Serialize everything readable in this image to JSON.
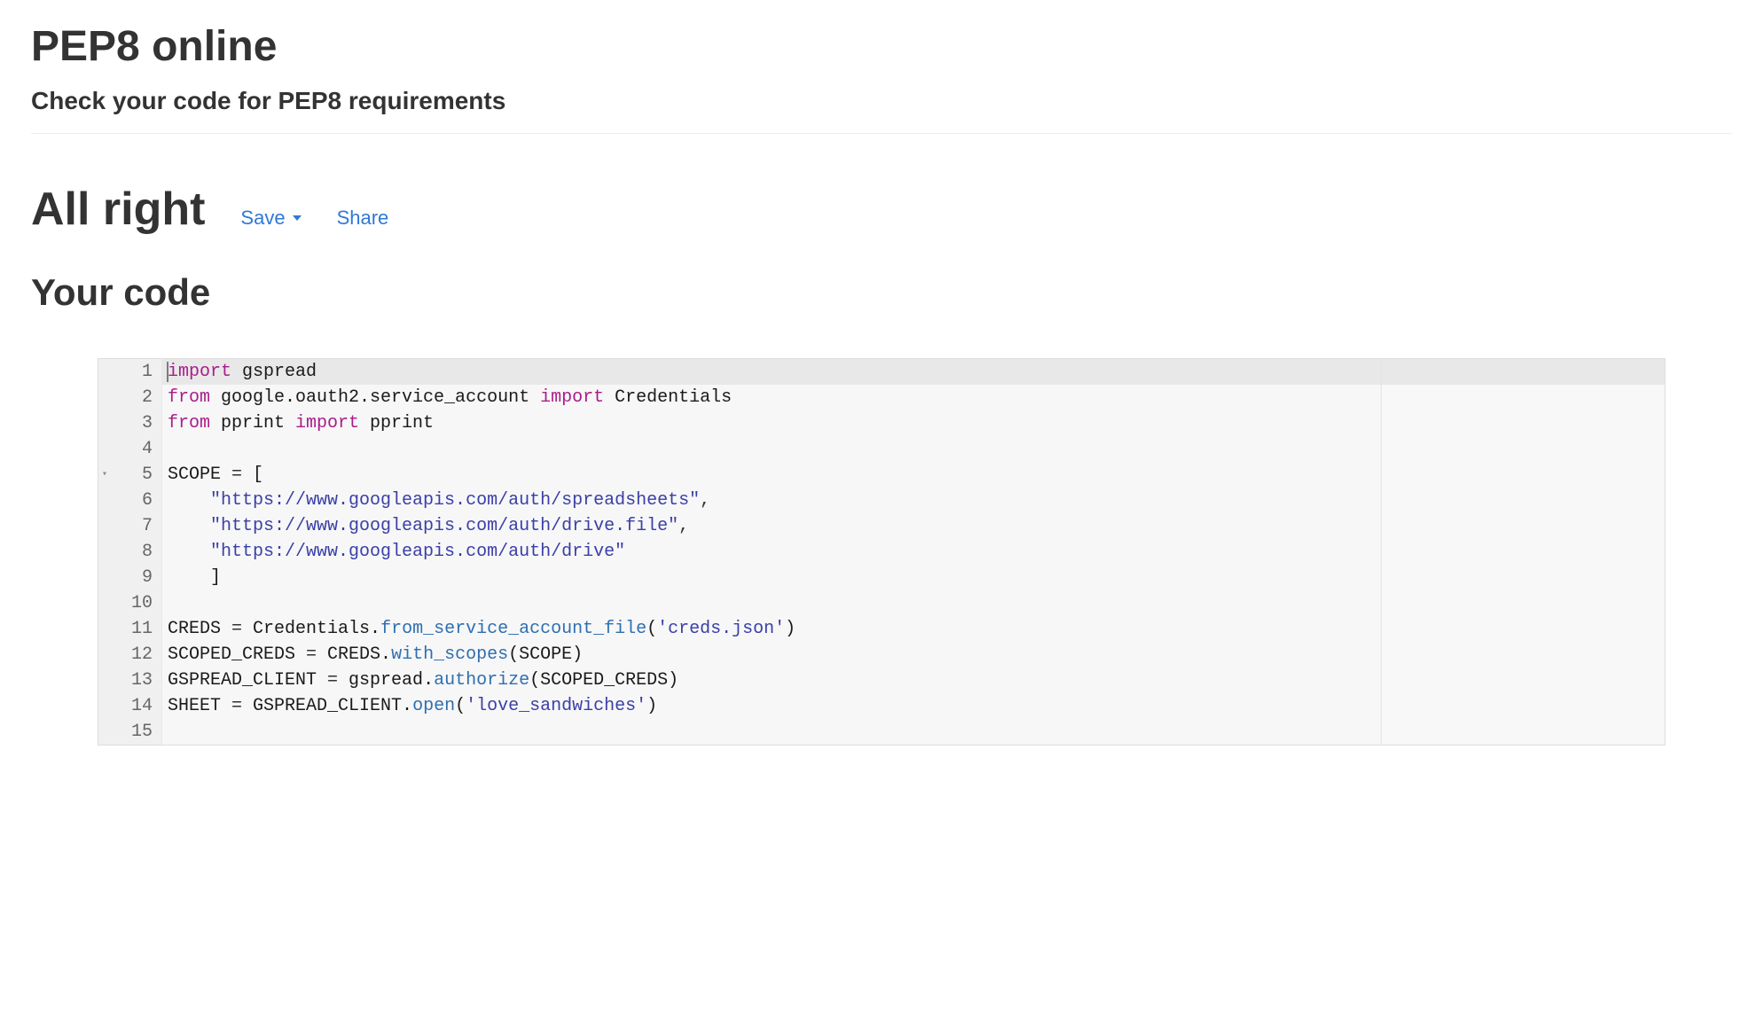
{
  "header": {
    "title": "PEP8 online",
    "subtitle": "Check your code for PEP8 requirements"
  },
  "status": {
    "label": "All right"
  },
  "actions": {
    "save_label": "Save",
    "share_label": "Share"
  },
  "section": {
    "your_code_label": "Your code"
  },
  "editor": {
    "line_numbers": [
      "1",
      "2",
      "3",
      "4",
      "5",
      "6",
      "7",
      "8",
      "9",
      "10",
      "11",
      "12",
      "13",
      "14",
      "15"
    ],
    "fold_line": 5,
    "active_line": 1,
    "code_lines": [
      {
        "tokens": [
          {
            "t": "import",
            "c": "tok-keyword"
          },
          {
            "t": " gspread",
            "c": "tok-name"
          }
        ]
      },
      {
        "tokens": [
          {
            "t": "from",
            "c": "tok-keyword"
          },
          {
            "t": " google.oauth2.service_account ",
            "c": "tok-name"
          },
          {
            "t": "import",
            "c": "tok-keyword"
          },
          {
            "t": " Credentials",
            "c": "tok-name"
          }
        ]
      },
      {
        "tokens": [
          {
            "t": "from",
            "c": "tok-keyword"
          },
          {
            "t": " pprint ",
            "c": "tok-name"
          },
          {
            "t": "import",
            "c": "tok-keyword"
          },
          {
            "t": " pprint",
            "c": "tok-name"
          }
        ]
      },
      {
        "tokens": []
      },
      {
        "tokens": [
          {
            "t": "SCOPE ",
            "c": "tok-name"
          },
          {
            "t": "=",
            "c": "tok-op"
          },
          {
            "t": " [",
            "c": "tok-name"
          }
        ]
      },
      {
        "tokens": [
          {
            "t": "    ",
            "c": ""
          },
          {
            "t": "\"https://www.googleapis.com/auth/spreadsheets\"",
            "c": "tok-string"
          },
          {
            "t": ",",
            "c": "tok-op"
          }
        ]
      },
      {
        "tokens": [
          {
            "t": "    ",
            "c": ""
          },
          {
            "t": "\"https://www.googleapis.com/auth/drive.file\"",
            "c": "tok-string"
          },
          {
            "t": ",",
            "c": "tok-op"
          }
        ]
      },
      {
        "tokens": [
          {
            "t": "    ",
            "c": ""
          },
          {
            "t": "\"https://www.googleapis.com/auth/drive\"",
            "c": "tok-string"
          }
        ]
      },
      {
        "tokens": [
          {
            "t": "    ]",
            "c": "tok-name"
          }
        ]
      },
      {
        "tokens": []
      },
      {
        "tokens": [
          {
            "t": "CREDS ",
            "c": "tok-name"
          },
          {
            "t": "=",
            "c": "tok-op"
          },
          {
            "t": " Credentials.",
            "c": "tok-name"
          },
          {
            "t": "from_service_account_file",
            "c": "tok-func"
          },
          {
            "t": "(",
            "c": "tok-name"
          },
          {
            "t": "'creds.json'",
            "c": "tok-string"
          },
          {
            "t": ")",
            "c": "tok-name"
          }
        ]
      },
      {
        "tokens": [
          {
            "t": "SCOPED_CREDS ",
            "c": "tok-name"
          },
          {
            "t": "=",
            "c": "tok-op"
          },
          {
            "t": " CREDS.",
            "c": "tok-name"
          },
          {
            "t": "with_scopes",
            "c": "tok-func"
          },
          {
            "t": "(SCOPE)",
            "c": "tok-name"
          }
        ]
      },
      {
        "tokens": [
          {
            "t": "GSPREAD_CLIENT ",
            "c": "tok-name"
          },
          {
            "t": "=",
            "c": "tok-op"
          },
          {
            "t": " gspread.",
            "c": "tok-name"
          },
          {
            "t": "authorize",
            "c": "tok-func"
          },
          {
            "t": "(SCOPED_CREDS)",
            "c": "tok-name"
          }
        ]
      },
      {
        "tokens": [
          {
            "t": "SHEET ",
            "c": "tok-name"
          },
          {
            "t": "=",
            "c": "tok-op"
          },
          {
            "t": " GSPREAD_CLIENT.",
            "c": "tok-name"
          },
          {
            "t": "open",
            "c": "tok-func"
          },
          {
            "t": "(",
            "c": "tok-name"
          },
          {
            "t": "'love_sandwiches'",
            "c": "tok-string"
          },
          {
            "t": ")",
            "c": "tok-name"
          }
        ]
      },
      {
        "tokens": []
      }
    ]
  }
}
